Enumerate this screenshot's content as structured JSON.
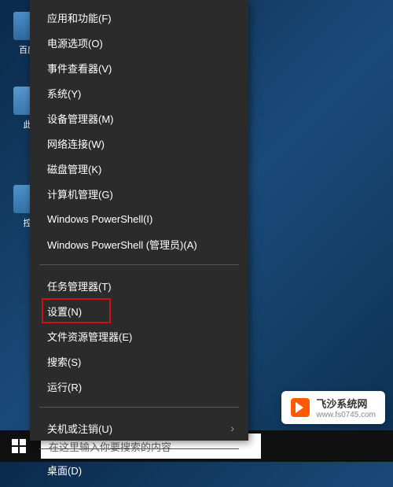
{
  "desktop": {
    "icon1_label": "百度",
    "icon2_label": "此",
    "icon3_label": "控"
  },
  "menu": {
    "apps_features": "应用和功能(F)",
    "power_options": "电源选项(O)",
    "event_viewer": "事件查看器(V)",
    "system": "系统(Y)",
    "device_manager": "设备管理器(M)",
    "network_connections": "网络连接(W)",
    "disk_management": "磁盘管理(K)",
    "computer_management": "计算机管理(G)",
    "powershell": "Windows PowerShell(I)",
    "powershell_admin": "Windows PowerShell (管理员)(A)",
    "task_manager": "任务管理器(T)",
    "settings": "设置(N)",
    "file_explorer": "文件资源管理器(E)",
    "search": "搜索(S)",
    "run": "运行(R)",
    "shutdown": "关机或注销(U)",
    "desktop": "桌面(D)"
  },
  "taskbar": {
    "search_placeholder": "在这里输入你要搜索的内容"
  },
  "watermark": {
    "title": "飞沙系统网",
    "url": "www.fs0745.com"
  }
}
